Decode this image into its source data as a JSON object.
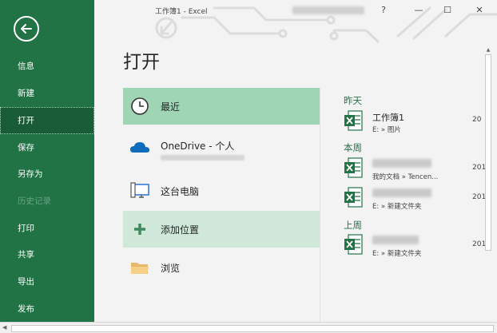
{
  "window": {
    "title": "工作簿1  -  Excel",
    "help": "?",
    "minimize": "—",
    "maximize": "☐",
    "close": "✕"
  },
  "colors": {
    "accent": "#217346",
    "nav_active": "#1a5c38",
    "selected_location": "#9fd5b5",
    "hover_location": "#cfe8d9"
  },
  "nav": [
    {
      "label": "信息",
      "state": "normal"
    },
    {
      "label": "新建",
      "state": "normal"
    },
    {
      "label": "打开",
      "state": "active"
    },
    {
      "label": "保存",
      "state": "normal"
    },
    {
      "label": "另存为",
      "state": "normal"
    },
    {
      "label": "历史记录",
      "state": "disabled"
    },
    {
      "label": "打印",
      "state": "normal"
    },
    {
      "label": "共享",
      "state": "normal"
    },
    {
      "label": "导出",
      "state": "normal"
    },
    {
      "label": "发布",
      "state": "normal"
    }
  ],
  "page_title": "打开",
  "locations": [
    {
      "label": "最近",
      "icon": "clock-icon"
    },
    {
      "label": "OneDrive - 个人",
      "icon": "cloud-icon"
    },
    {
      "label": "这台电脑",
      "icon": "computer-icon"
    },
    {
      "label": "添加位置",
      "icon": "plus-icon"
    },
    {
      "label": "浏览",
      "icon": "folder-icon"
    }
  ],
  "recent": {
    "groups": [
      {
        "label": "昨天"
      },
      {
        "label": "本周"
      },
      {
        "label": "上周"
      }
    ],
    "files": [
      {
        "name": "工作簿1",
        "path": "E: » 图片",
        "date": "20"
      },
      {
        "name": "",
        "path": "我的文档 » Tencen...",
        "date": "201"
      },
      {
        "name": "",
        "path": "E: » 新建文件夹",
        "date": "201"
      },
      {
        "name": "",
        "path": "E: » 新建文件夹",
        "date": "201"
      }
    ]
  }
}
